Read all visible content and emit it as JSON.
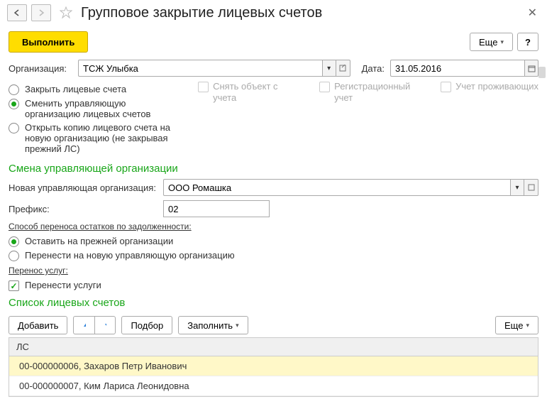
{
  "header": {
    "title": "Групповое закрытие лицевых счетов"
  },
  "toolbar": {
    "execute": "Выполнить",
    "more": "Еще",
    "help": "?"
  },
  "org_row": {
    "label": "Организация:",
    "value": "ТСЖ Улыбка",
    "date_label": "Дата:",
    "date_value": "31.05.2016"
  },
  "mode": {
    "close": "Закрыть лицевые счета",
    "change": "Сменить управляющую организацию лицевых счетов",
    "copy": "Открыть копию лицевого счета на новую организацию (не закрывая прежний ЛС)"
  },
  "checks": {
    "remove_object": "Снять объект с учета",
    "reg_accounting": "Регистрационный учет",
    "living_accounting": "Учет проживающих"
  },
  "change_section": {
    "title": "Смена управляющей организации",
    "new_org_label": "Новая управляющая организация:",
    "new_org_value": "ООО Ромашка",
    "prefix_label": "Префикс:",
    "prefix_value": "02",
    "debt_header": "Способ переноса остатков по задолженности:",
    "debt_keep": "Оставить на прежней организации",
    "debt_move": "Перенести на новую управляющую организацию",
    "services_header": "Перенос услуг:",
    "services_transfer": "Перенести услуги"
  },
  "list_section": {
    "title": "Список лицевых счетов",
    "add": "Добавить",
    "pick": "Подбор",
    "fill": "Заполнить",
    "more": "Еще",
    "col_header": "ЛС",
    "rows": [
      "00-000000006, Захаров Петр Иванович",
      "00-000000007, Ким Лариса Леонидовна"
    ]
  }
}
